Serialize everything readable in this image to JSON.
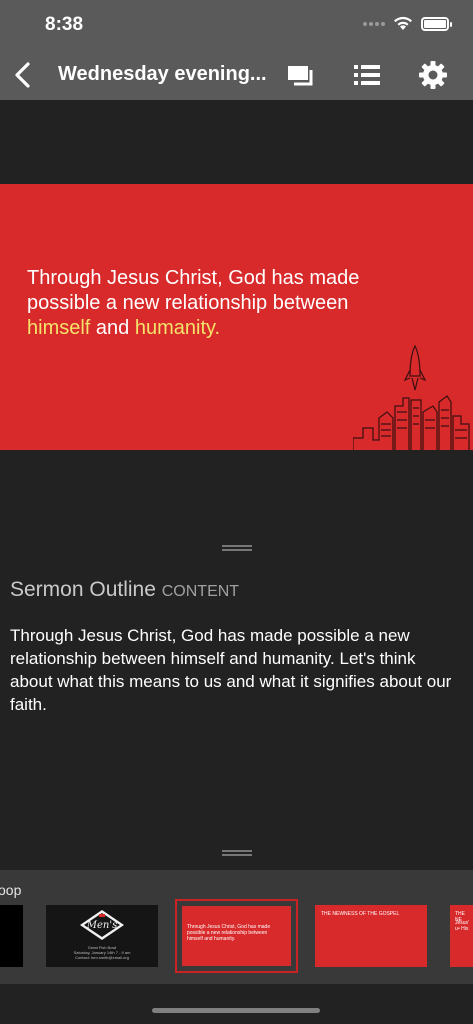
{
  "status_bar": {
    "time": "8:38"
  },
  "nav": {
    "title": "Wednesday evening...",
    "back_icon": "chevron-left-icon",
    "actions": [
      "slides-icon",
      "list-icon",
      "gear-icon"
    ]
  },
  "slide": {
    "line1": "Through Jesus Christ, God has made",
    "line2": "possible a new relationship between",
    "hl1": "himself",
    "and": "and",
    "hl2": "humanity",
    "end": ".",
    "background": "#d8292b",
    "highlight_color": "#f3e36a"
  },
  "notes": {
    "heading": "Sermon Outline",
    "tag": "CONTENT",
    "body": "Through Jesus Christ, God has made possible a new relationship between himself and humanity. Let's think about what this means to us and what it signifies about our faith."
  },
  "tray": {
    "label": "oop",
    "thumbs": [
      {
        "name": "blank"
      },
      {
        "name": "mens-breakfast",
        "logo": "Men's",
        "lines": [
          "Great Fish Bowl",
          "Saturday, January 14th 7 - 9 am",
          "Contact: tom.smith@email.org"
        ]
      },
      {
        "name": "current",
        "text": "Through Jesus Christ, God has made possible a new relationship between himself and humanity."
      },
      {
        "name": "newness",
        "text": "THE NEWNESS OF THE GOSPEL"
      },
      {
        "name": "partial",
        "text": "THE NE",
        "sub": "Jesus' u",
        "sub2": "• His"
      }
    ]
  }
}
